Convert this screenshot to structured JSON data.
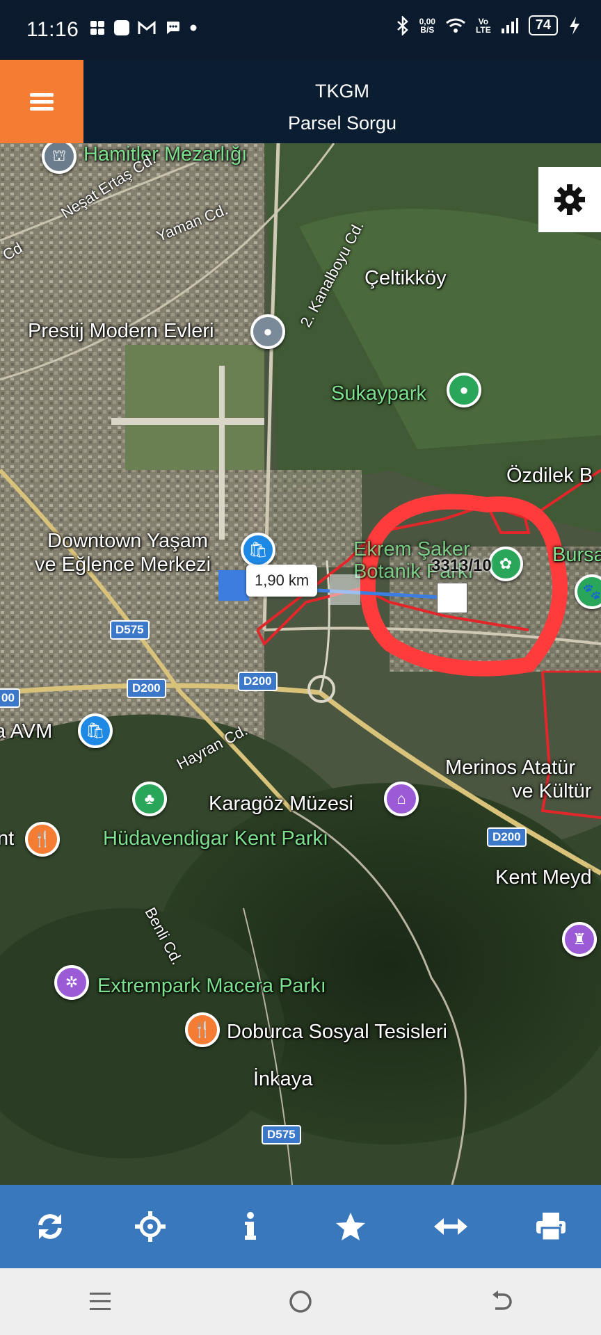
{
  "status": {
    "time": "11:16",
    "net_speed_top": "0,00",
    "net_speed_bottom": "B/S",
    "lte_top": "Vo",
    "lte_bottom": "LTE",
    "battery": "74"
  },
  "header": {
    "title": "TKGM",
    "subtitle": "Parsel Sorgu"
  },
  "map": {
    "places": {
      "hamitler": "Hamitler Mezarlığı",
      "celtikkoy": "Çeltikköy",
      "prestij": "Prestij Modern Evleri",
      "sukaypark": "Sukaypark",
      "ozdilek": "Özdilek B",
      "downtown1": "Downtown Yaşam",
      "downtown2": "ve Eğlence Merkezi",
      "ekrem1": "Ekrem Şaker",
      "ekrem2": "Botanik Parkı",
      "bursa": "Bursa",
      "avm": "a AVM",
      "karagoz": "Karagöz Müzesi",
      "hudavendigar": "Hüdavendigar Kent Parkı",
      "nt": "nt",
      "merinos1": "Merinos Atatür",
      "merinos2": "ve Kültür",
      "kentmeydan": "Kent Meyd",
      "extrempark": "Extrempark Macera Parkı",
      "doburca": "Doburca Sosyal Tesisleri",
      "inkaya": "İnkaya"
    },
    "roads": {
      "nesat": "Neşat Ertaş Cd.",
      "yaman": "Yaman Cd.",
      "kanalboyu": "2. Kanalboyu Cd.",
      "cd": "Cd",
      "hayran": "Hayran Cd.",
      "benli": "Benli Cd."
    },
    "shields": {
      "d575a": "D575",
      "d200a": "D200",
      "d200b": "D200",
      "d200c": "D200",
      "d200d": "00",
      "d575b": "D575"
    },
    "measure_distance": "1,90 km",
    "parcel_label": "3313/10"
  },
  "toolbar": {
    "icons": [
      "refresh-icon",
      "locate-icon",
      "info-icon",
      "star-icon",
      "measure-icon",
      "print-icon"
    ]
  },
  "colors": {
    "header_bg": "#0b1e31",
    "menu_accent": "#f47c33",
    "toolbar_bg": "#3a78bd",
    "parcel_outline": "#e2262a",
    "annotation_circle": "#ff3b3b"
  }
}
